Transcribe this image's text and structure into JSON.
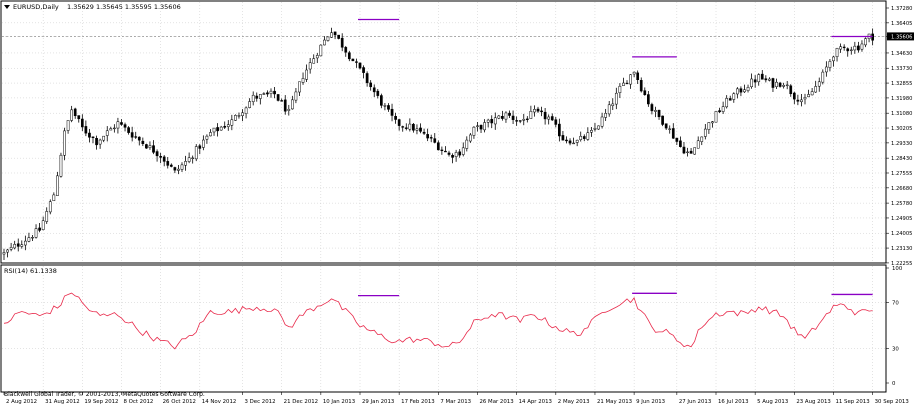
{
  "header": {
    "symbol_title": "EURUSD,Daily",
    "ohlc": "1.35629 1.35645 1.35595 1.35606"
  },
  "rsi_label": "RSI(14) 61.1338",
  "footer_text": "Blackwell Global Trader, © 2001-2013, MetaQuotes Software Corp.",
  "colors": {
    "background": "#ffffff",
    "candle": "#000000",
    "rsi_line": "#e8294a",
    "marker": "#8a00c4",
    "grid": "#c8c8c8",
    "current_price_bg": "#000000"
  },
  "chart_data": [
    {
      "type": "candlestick",
      "symbol": "EURUSD",
      "timeframe": "Daily",
      "ylim": [
        1.2225,
        1.3728
      ],
      "price_ticks": [
        "1.37280",
        "1.36405",
        "1.35606",
        "1.34630",
        "1.33730",
        "1.32855",
        "1.31980",
        "1.31080",
        "1.30205",
        "1.29330",
        "1.28430",
        "1.27555",
        "1.26680",
        "1.25780",
        "1.24905",
        "1.24005",
        "1.23130",
        "1.22255"
      ],
      "current_price": "1.35606",
      "date_ticks": [
        "2 Aug 2012",
        "31 Aug 2012",
        "19 Sep 2012",
        "8 Oct 2012",
        "26 Oct 2012",
        "14 Nov 2012",
        "3 Dec 2012",
        "21 Dec 2012",
        "10 Jan 2013",
        "29 Jan 2013",
        "17 Feb 2013",
        "7 Mar 2013",
        "26 Mar 2013",
        "14 Apr 2013",
        "2 May 2013",
        "21 May 2013",
        "9 Jun 2013",
        "27 Jun 2013",
        "16 Jul 2013",
        "5 Aug 2013",
        "23 Aug 2013",
        "11 Sep 2013",
        "30 Sep 2013"
      ],
      "close_anchors": [
        [
          0,
          1.228
        ],
        [
          10,
          1.242
        ],
        [
          14,
          1.263
        ],
        [
          17,
          1.299
        ],
        [
          19,
          1.313
        ],
        [
          22,
          1.302
        ],
        [
          26,
          1.294
        ],
        [
          32,
          1.305
        ],
        [
          38,
          1.295
        ],
        [
          44,
          1.286
        ],
        [
          48,
          1.276
        ],
        [
          52,
          1.284
        ],
        [
          58,
          1.299
        ],
        [
          64,
          1.306
        ],
        [
          70,
          1.32
        ],
        [
          76,
          1.322
        ],
        [
          80,
          1.311
        ],
        [
          84,
          1.333
        ],
        [
          88,
          1.347
        ],
        [
          92,
          1.36
        ],
        [
          96,
          1.348
        ],
        [
          100,
          1.336
        ],
        [
          105,
          1.32
        ],
        [
          110,
          1.305
        ],
        [
          115,
          1.302
        ],
        [
          120,
          1.295
        ],
        [
          125,
          1.286
        ],
        [
          128,
          1.288
        ],
        [
          132,
          1.301
        ],
        [
          137,
          1.306
        ],
        [
          141,
          1.31
        ],
        [
          145,
          1.306
        ],
        [
          149,
          1.311
        ],
        [
          153,
          1.308
        ],
        [
          157,
          1.296
        ],
        [
          161,
          1.294
        ],
        [
          165,
          1.299
        ],
        [
          169,
          1.31
        ],
        [
          173,
          1.325
        ],
        [
          177,
          1.336
        ],
        [
          179,
          1.326
        ],
        [
          182,
          1.313
        ],
        [
          186,
          1.304
        ],
        [
          190,
          1.291
        ],
        [
          193,
          1.286
        ],
        [
          196,
          1.299
        ],
        [
          200,
          1.31
        ],
        [
          204,
          1.32
        ],
        [
          208,
          1.326
        ],
        [
          212,
          1.332
        ],
        [
          216,
          1.328
        ],
        [
          219,
          1.329
        ],
        [
          222,
          1.321
        ],
        [
          225,
          1.318
        ],
        [
          229,
          1.329
        ],
        [
          233,
          1.346
        ],
        [
          236,
          1.349
        ],
        [
          240,
          1.35
        ],
        [
          243,
          1.356
        ],
        [
          244,
          1.356
        ]
      ],
      "resistance_markers": [
        {
          "start": "29 Jan 2013",
          "end": "17 Feb 2013",
          "price": 1.366
        },
        {
          "start": "9 Jun 2013",
          "end": "27 Jun 2013",
          "price": 1.344
        },
        {
          "start": "11 Sep 2013",
          "end": "30 Sep 2013",
          "price": 1.356
        }
      ]
    },
    {
      "type": "line",
      "name": "RSI(14)",
      "ylim": [
        0,
        100
      ],
      "levels": [
        "100",
        "70",
        "30",
        "0"
      ],
      "anchors": [
        [
          0,
          52
        ],
        [
          5,
          62
        ],
        [
          10,
          58
        ],
        [
          15,
          66
        ],
        [
          19,
          80
        ],
        [
          23,
          66
        ],
        [
          27,
          58
        ],
        [
          32,
          60
        ],
        [
          38,
          46
        ],
        [
          44,
          36
        ],
        [
          48,
          32
        ],
        [
          53,
          42
        ],
        [
          58,
          62
        ],
        [
          64,
          62
        ],
        [
          70,
          66
        ],
        [
          76,
          64
        ],
        [
          80,
          48
        ],
        [
          84,
          60
        ],
        [
          88,
          67
        ],
        [
          92,
          74
        ],
        [
          96,
          62
        ],
        [
          100,
          50
        ],
        [
          105,
          42
        ],
        [
          110,
          36
        ],
        [
          115,
          38
        ],
        [
          120,
          36
        ],
        [
          125,
          31
        ],
        [
          128,
          36
        ],
        [
          132,
          52
        ],
        [
          137,
          60
        ],
        [
          141,
          58
        ],
        [
          145,
          54
        ],
        [
          149,
          60
        ],
        [
          153,
          52
        ],
        [
          157,
          46
        ],
        [
          161,
          42
        ],
        [
          165,
          52
        ],
        [
          169,
          64
        ],
        [
          173,
          70
        ],
        [
          177,
          73
        ],
        [
          179,
          62
        ],
        [
          182,
          48
        ],
        [
          186,
          44
        ],
        [
          190,
          36
        ],
        [
          193,
          31
        ],
        [
          196,
          50
        ],
        [
          200,
          60
        ],
        [
          204,
          62
        ],
        [
          208,
          60
        ],
        [
          212,
          66
        ],
        [
          216,
          62
        ],
        [
          219,
          58
        ],
        [
          222,
          46
        ],
        [
          225,
          38
        ],
        [
          229,
          52
        ],
        [
          233,
          66
        ],
        [
          236,
          68
        ],
        [
          240,
          60
        ],
        [
          243,
          64
        ],
        [
          244,
          61
        ]
      ],
      "markers": [
        {
          "start": "29 Jan 2013",
          "end": "17 Feb 2013",
          "value": 76
        },
        {
          "start": "9 Jun 2013",
          "end": "27 Jun 2013",
          "value": 78
        },
        {
          "start": "11 Sep 2013",
          "end": "30 Sep 2013",
          "value": 77
        }
      ]
    }
  ]
}
